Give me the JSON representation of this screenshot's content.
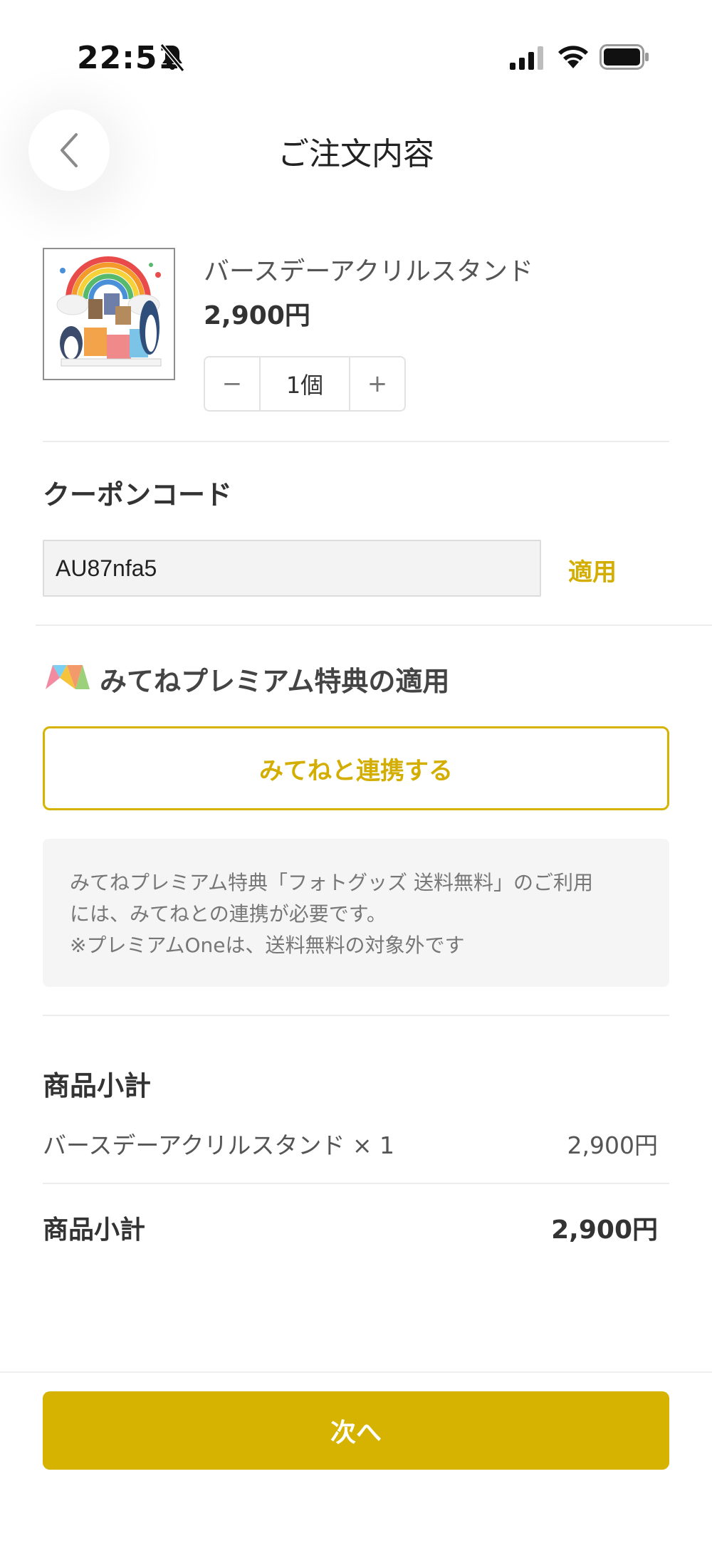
{
  "status_bar": {
    "time": "22:51"
  },
  "header": {
    "title": "ご注文内容"
  },
  "product": {
    "name": "バースデーアクリルスタンド",
    "price": "2,900円",
    "quantity": "1個",
    "minus": "−",
    "plus": "+"
  },
  "coupon": {
    "title": "クーポンコード",
    "code": "AU87nfa5",
    "apply_label": "適用"
  },
  "premium": {
    "title": "みてねプレミアム特典の適用",
    "link_button": "みてねと連携する",
    "info_line1": "みてねプレミアム特典「フォトグッズ 送料無料」のご利用",
    "info_line2": "には、みてねとの連携が必要です。",
    "info_line3": "※プレミアムOneは、送料無料の対象外です"
  },
  "subtotal": {
    "title": "商品小計",
    "item_label": "バースデーアクリルスタンド × 1",
    "item_price": "2,900円",
    "total_label": "商品小計",
    "total_value": "2,900円"
  },
  "footer": {
    "next_label": "次へ"
  },
  "colors": {
    "accent": "#d6b300",
    "accent_text": "#d3ae00"
  }
}
